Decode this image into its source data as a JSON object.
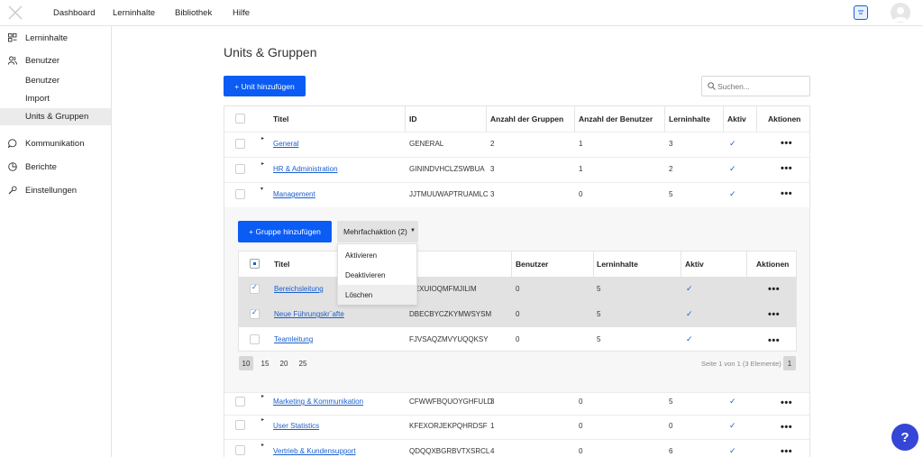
{
  "nav": {
    "items": [
      "Dashboard",
      "Lerninhalte",
      "Bibliothek",
      "Hilfe"
    ]
  },
  "sidebar": {
    "items": [
      {
        "label": "Lerninhalte",
        "icon": "lerninhalte-icon"
      },
      {
        "label": "Benutzer",
        "icon": "users-icon"
      },
      {
        "label": "Kommunikation",
        "icon": "chat-icon"
      },
      {
        "label": "Berichte",
        "icon": "reports-icon"
      },
      {
        "label": "Einstellungen",
        "icon": "wrench-icon"
      }
    ],
    "subitems": [
      "Benutzer",
      "Import",
      "Units & Gruppen"
    ]
  },
  "page": {
    "title": "Units & Gruppen",
    "add_unit_label": "+ Unit hinzufügen",
    "search_placeholder": "Suchen..."
  },
  "table": {
    "headers": [
      "Titel",
      "ID",
      "Anzahl der Gruppen",
      "Anzahl der Benutzer",
      "Lerninhalte",
      "Aktiv",
      "Aktionen"
    ],
    "rows_top": [
      {
        "title": "General",
        "id": "GENERAL",
        "groups": "2",
        "users": "1",
        "content": "3",
        "expanded": false
      },
      {
        "title": "HR & Administration",
        "id": "GININDVHCLZSWBUA",
        "groups": "3",
        "users": "1",
        "content": "2",
        "expanded": false
      },
      {
        "title": "Management",
        "id": "JJTMUUWAPTRUAMLC",
        "groups": "3",
        "users": "0",
        "content": "5",
        "expanded": true
      }
    ],
    "rows_bottom": [
      {
        "title": "Marketing & Kommunikation",
        "id": "CFWWFBQUOYGHFULD",
        "groups": "3",
        "users": "0",
        "content": "5"
      },
      {
        "title": "User Statistics",
        "id": "KFEXORJEKPQHRDSF",
        "groups": "1",
        "users": "0",
        "content": "0"
      },
      {
        "title": "Vertrieb & Kundensupport",
        "id": "QDQQXBGRBVTXSRCL",
        "groups": "4",
        "users": "0",
        "content": "6"
      }
    ]
  },
  "group_panel": {
    "add_group_label": "+ Gruppe hinzufügen",
    "bulk_action_label": "Mehrfachaktion (2)",
    "bulk_options": [
      "Aktivieren",
      "Deaktivieren",
      "Löschen"
    ],
    "headers": [
      "Titel",
      "Benutzer",
      "Lerninhalte",
      "Aktiv",
      "Aktionen"
    ],
    "rows": [
      {
        "title": "Bereichsleitung",
        "id": "NEXUIOQMFMJILIM",
        "users": "0",
        "content": "5",
        "selected": true
      },
      {
        "title": "Neue Führungskr¨afte",
        "id": "DBECBYCZKYMWSYSM",
        "users": "0",
        "content": "5",
        "selected": true
      },
      {
        "title": "Teamleitung",
        "id": "FJVSAQZMVYUQQKSY",
        "users": "0",
        "content": "5",
        "selected": false
      }
    ],
    "page_sizes": [
      "10",
      "15",
      "20",
      "25"
    ],
    "page_size_selected": "10",
    "page_info": "Seite 1 von 1 (3 Elemente)",
    "current_page": "1"
  },
  "help_label": "?",
  "colors": {
    "primary": "#0a5cf5",
    "link": "#1a5fcf",
    "help": "#3545d6"
  }
}
